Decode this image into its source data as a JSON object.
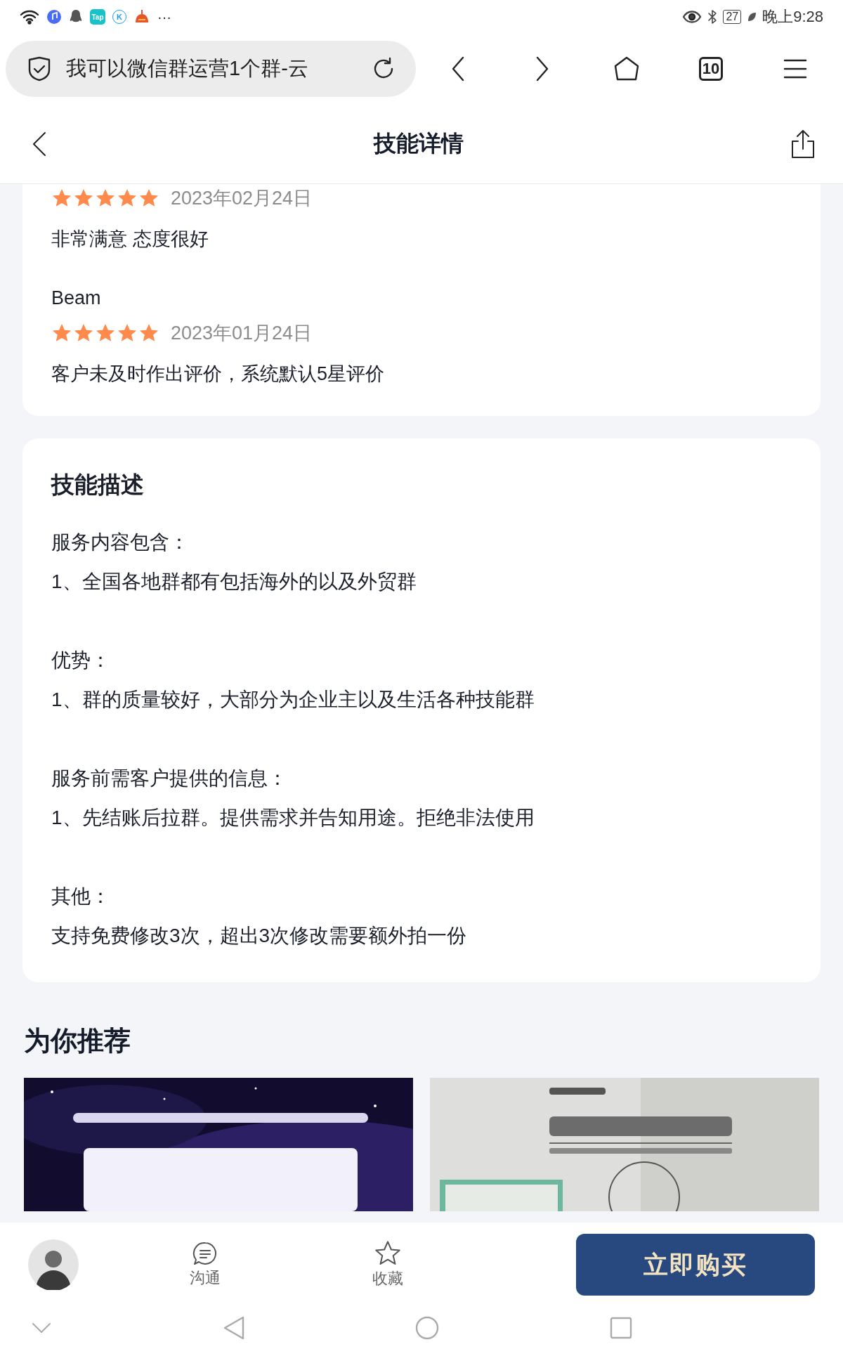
{
  "status_bar": {
    "app_labels": [
      "Tap",
      "K"
    ],
    "more": "···",
    "battery": "27",
    "time": "晚上9:28"
  },
  "browser": {
    "page_title": "我可以微信群运营1个群-云",
    "tab_count": "10"
  },
  "header": {
    "title": "技能详情"
  },
  "reviews": [
    {
      "stars": 5,
      "date": "2023年02月24日",
      "text": "非常满意 态度很好"
    },
    {
      "name": "Beam",
      "stars": 5,
      "date": "2023年01月24日",
      "text": "客户未及时作出评价，系统默认5星评价"
    }
  ],
  "description": {
    "title": "技能描述",
    "paragraphs": [
      [
        "服务内容包含：",
        "1、全国各地群都有包括海外的以及外贸群"
      ],
      [
        "优势：",
        "1、群的质量较好，大部分为企业主以及生活各种技能群"
      ],
      [
        "服务前需客户提供的信息：",
        "1、先结账后拉群。提供需求并告知用途。拒绝非法使用"
      ],
      [
        "其他：",
        "支持免费修改3次，超出3次修改需要额外拍一份"
      ]
    ]
  },
  "recommend": {
    "title": "为你推荐"
  },
  "bottom_bar": {
    "actions": [
      {
        "kind": "chat",
        "label": "沟通"
      },
      {
        "kind": "star",
        "label": "收藏"
      }
    ],
    "buy_button": "立即购买"
  }
}
